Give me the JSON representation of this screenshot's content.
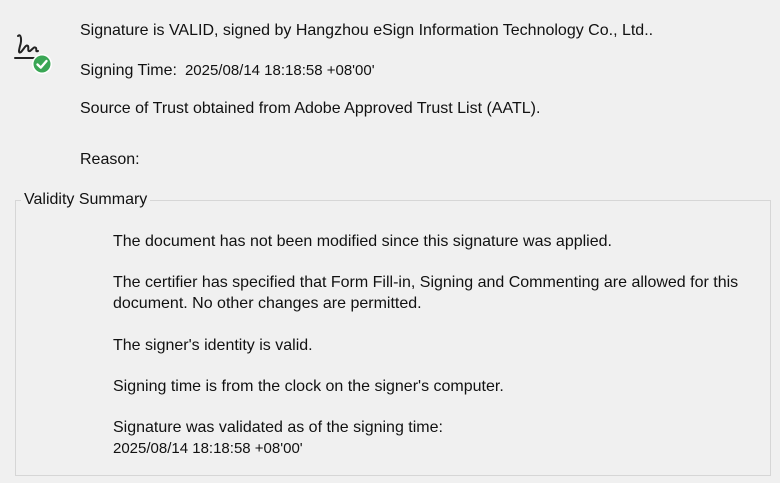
{
  "signature": {
    "status": "Signature is VALID, signed by Hangzhou eSign Information Technology Co., Ltd..",
    "signing_time_label": "Signing Time:",
    "signing_time_value": "2025/08/14 18:18:58 +08'00'",
    "trust_source": "Source of Trust obtained from Adobe Approved Trust List (AATL).",
    "reason_label": "Reason:",
    "icon": "signature-valid-icon",
    "valid_color": "#3aa655"
  },
  "validity_summary": {
    "title": "Validity Summary",
    "items": [
      "The document has not been modified since this signature was applied.",
      "The certifier has specified that Form Fill-in, Signing and Commenting are allowed for this document. No other changes are permitted.",
      "The signer's identity is valid.",
      "Signing time is from the clock on the signer's computer.",
      "Signature was validated as of the signing time:"
    ],
    "validated_time": "2025/08/14 18:18:58 +08'00'"
  }
}
